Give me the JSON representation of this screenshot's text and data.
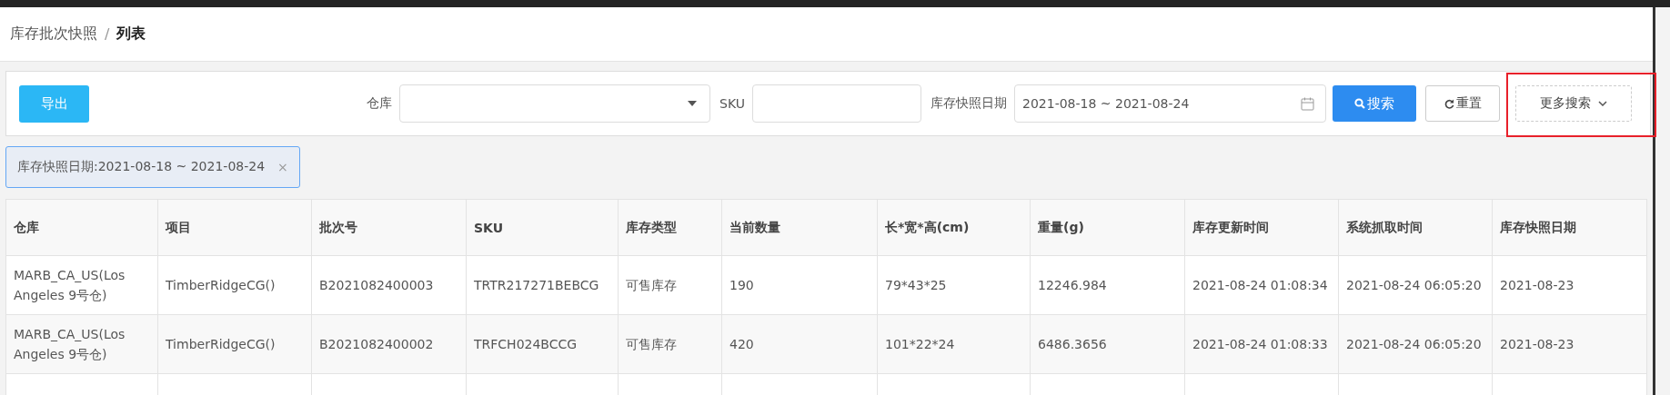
{
  "breadcrumb": {
    "parent": "库存批次快照",
    "separator": "/",
    "current": "列表"
  },
  "toolbar": {
    "export_button": "导出",
    "filters": [
      {
        "kind": "select",
        "label": "仓库"
      },
      {
        "kind": "input",
        "label": "SKU"
      },
      {
        "kind": "date",
        "label": "库存快照日期",
        "value": "2021-08-18 ~ 2021-08-24"
      }
    ],
    "search_button": "搜索",
    "reset_button": "重置",
    "more_button": "更多搜索"
  },
  "active_filters": [
    {
      "label": "库存快照日期:2021-08-18 ~ 2021-08-24",
      "close": "×"
    }
  ],
  "table": {
    "columns": [
      "仓库",
      "项目",
      "批次号",
      "SKU",
      "库存类型",
      "当前数量",
      "长*宽*高(cm)",
      "重量(g)",
      "库存更新时间",
      "系统抓取时间",
      "库存快照日期"
    ],
    "rows": [
      [
        "MARB_CA_US(Los Angeles 9号仓)",
        "TimberRidgeCG()",
        "B2021082400003",
        "TRTR217271BEBCG",
        "可售库存",
        "190",
        "79*43*25",
        "12246.984",
        "2021-08-24 01:08:34",
        "2021-08-24 06:05:20",
        "2021-08-23"
      ],
      [
        "MARB_CA_US(Los Angeles 9号仓)",
        "TimberRidgeCG()",
        "B2021082400002",
        "TRFCH024BCCG",
        "可售库存",
        "420",
        "101*22*24",
        "6486.3656",
        "2021-08-24 01:08:33",
        "2021-08-24 06:05:20",
        "2021-08-23"
      ]
    ]
  }
}
